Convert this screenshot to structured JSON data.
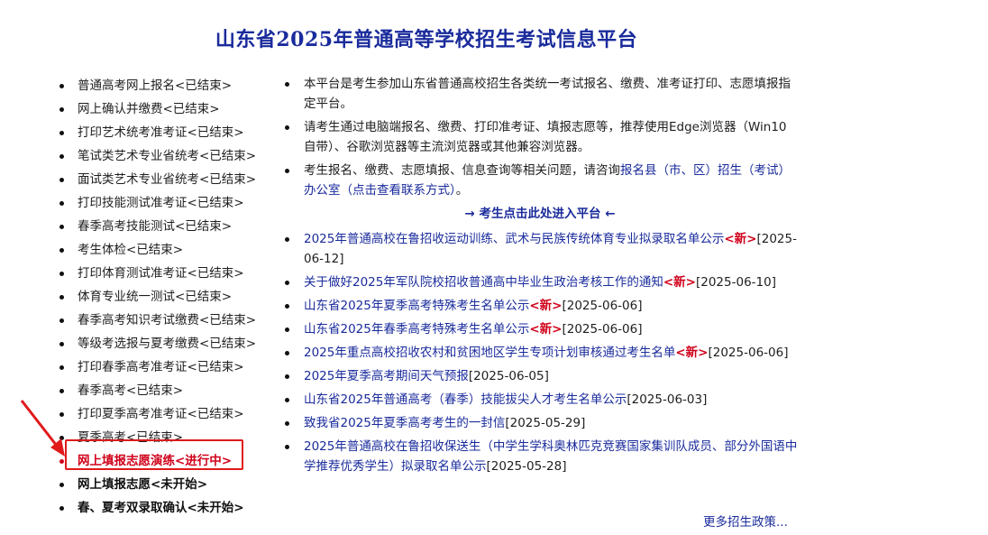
{
  "page_title": "山东省2025年普通高等学校招生考试信息平台",
  "left_menu": [
    {
      "label": "普通高考网上报名<已结束>",
      "state": "ended"
    },
    {
      "label": "网上确认并缴费<已结束>",
      "state": "ended"
    },
    {
      "label": "打印艺术统考准考证<已结束>",
      "state": "ended"
    },
    {
      "label": "笔试类艺术专业省统考<已结束>",
      "state": "ended"
    },
    {
      "label": "面试类艺术专业省统考<已结束>",
      "state": "ended"
    },
    {
      "label": "打印技能测试准考证<已结束>",
      "state": "ended"
    },
    {
      "label": "春季高考技能测试<已结束>",
      "state": "ended"
    },
    {
      "label": "考生体检<已结束>",
      "state": "ended"
    },
    {
      "label": "打印体育测试准考证<已结束>",
      "state": "ended"
    },
    {
      "label": "体育专业统一测试<已结束>",
      "state": "ended"
    },
    {
      "label": "春季高考知识考试缴费<已结束>",
      "state": "ended"
    },
    {
      "label": "等级考选报与夏考缴费<已结束>",
      "state": "ended"
    },
    {
      "label": "打印春季高考准考证<已结束>",
      "state": "ended"
    },
    {
      "label": "春季高考<已结束>",
      "state": "ended"
    },
    {
      "label": "打印夏季高考准考证<已结束>",
      "state": "ended"
    },
    {
      "label": "夏季高考<已结束>",
      "state": "ended"
    },
    {
      "label": "网上填报志愿演练<进行中>",
      "state": "current"
    },
    {
      "label": "网上填报志愿<未开始>",
      "state": "pending"
    },
    {
      "label": "春、夏考双录取确认<未开始>",
      "state": "pending"
    }
  ],
  "info": {
    "item1": "本平台是考生参加山东省普通高校招生各类统一考试报名、缴费、准考证打印、志愿填报指定平台。",
    "item2": "请考生通过电脑端报名、缴费、打印准考证、填报志愿等，推荐使用Edge浏览器（Win10自带）、谷歌浏览器等主流浏览器或其他兼容浏览器。",
    "item3_prefix": "考生报名、缴费、志愿填报、信息查询等相关问题，请咨询",
    "item3_link": "报名县（市、区）招生（考试）办公室（点击查看联系方式）",
    "item3_suffix": "。"
  },
  "enter_link": "→ 考生点击此处进入平台 ←",
  "news": [
    {
      "title": "2025年普通高校在鲁招收运动训练、武术与民族传统体育专业拟录取名单公示",
      "new": "<新>",
      "date": "[2025-06-12]"
    },
    {
      "title": "关于做好2025年军队院校招收普通高中毕业生政治考核工作的通知",
      "new": "<新>",
      "date": "[2025-06-10]"
    },
    {
      "title": "山东省2025年夏季高考特殊考生名单公示",
      "new": "<新>",
      "date": "[2025-06-06]"
    },
    {
      "title": "山东省2025年春季高考特殊考生名单公示",
      "new": "<新>",
      "date": "[2025-06-06]"
    },
    {
      "title": "2025年重点高校招收农村和贫困地区学生专项计划审核通过考生名单",
      "new": "<新>",
      "date": "[2025-06-06]"
    },
    {
      "title": "2025年夏季高考期间天气预报",
      "new": "",
      "date": "[2025-06-05]"
    },
    {
      "title": "山东省2025年普通高考（春季）技能拔尖人才考生名单公示",
      "new": "",
      "date": "[2025-06-03]"
    },
    {
      "title": "致我省2025年夏季高考考生的一封信",
      "new": "",
      "date": "[2025-05-29]"
    },
    {
      "title": "2025年普通高校在鲁招收保送生（中学生学科奥林匹克竞赛国家集训队成员、部分外国语中学推荐优秀学生）拟录取名单公示",
      "new": "",
      "date": "[2025-05-28]"
    }
  ],
  "more_link": "更多招生政策...",
  "colors": {
    "title": "#1a2b9c",
    "link": "#1a2b9c",
    "current": "#d0021b",
    "highlight": "#e0191b"
  }
}
